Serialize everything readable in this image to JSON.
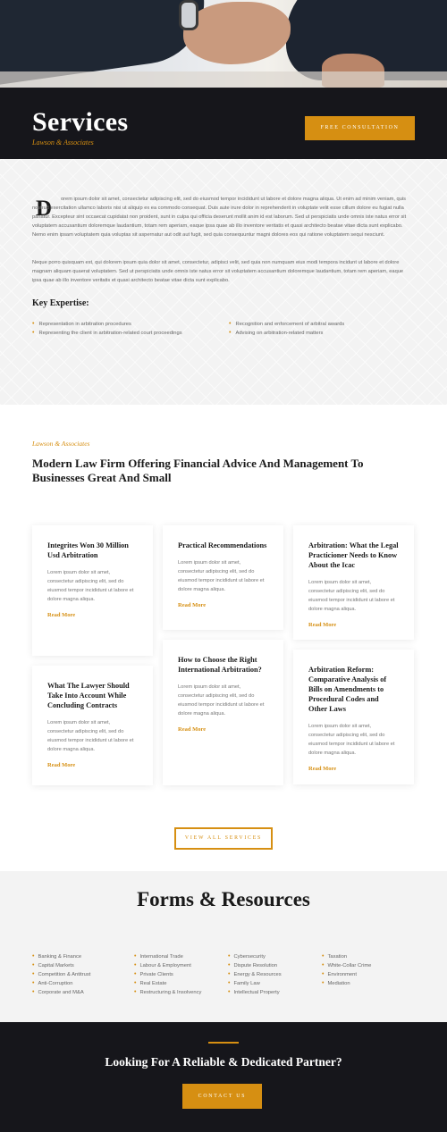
{
  "hero": {
    "title": "Services",
    "subtitle": "Lawson & Associates",
    "cta_label": "FREE CONSULTATION"
  },
  "intro": {
    "dropcap": "D",
    "paragraph1": "orem ipsum dolor sit amet, consectetur adipiscing elit, sed do eiusmod tempor incididunt ut labore et dolore magna aliqua. Ut enim ad minim veniam, quis nostrud exercitation ullamco laboris nisi ut aliquip ex ea commodo consequat. Duis aute irure dolor in reprehenderit in voluptate velit esse cillum dolore eu fugiat nulla pariatur. Excepteur sint occaecat cupidatat non proident, sunt in culpa qui officia deserunt mollit anim id est laborum. Sed ut perspiciatis unde omnis iste natus error sit voluptatem accusantium doloremque laudantium, totam rem aperiam, eaque ipsa quae ab illo inventore veritatis et quasi architecto beatae vitae dicta sunt explicabo. Nemo enim ipsam voluptatem quia voluptas sit aspernatur aut odit aut fugit, sed quia consequuntur magni dolores eos qui ratione voluptatem sequi nesciunt.",
    "paragraph2": "Neque porro quisquam est, qui dolorem ipsum quia dolor sit amet, consectetur, adipisci velit, sed quia non numquam eius modi tempora incidunt ut labore et dolore magnam aliquam quaerat voluptatem. Sed ut perspiciatis unde omnis iste natus error sit voluptatem accusantium doloremque laudantium, totam rem aperiam, eaque ipsa quae ab illo inventore veritatis et quasi architecto beatae vitae dicta sunt explicabo.",
    "expertise_title": "Key Expertise:",
    "expertise_left": [
      "Representation in arbitration procedures",
      "Representing the client in arbitration-related court proceedings"
    ],
    "expertise_right": [
      "Recognition and enforcement of arbitral awards",
      "Advising on arbitration-related matters"
    ]
  },
  "firm": {
    "eyebrow": "Lawson & Associates",
    "title": "Modern Law Firm Offering Financial Advice And Management To Businesses Great And Small",
    "read_more": "Read More",
    "cards": [
      {
        "title": "Integrites Won 30 Million Usd Arbitration",
        "body": "Lorem ipsum dolor sit amet, consectetur adipiscing elit, sed do eiusmod tempor incididunt ut labore et dolore magna aliqua."
      },
      {
        "title": "Practical Recommendations",
        "body": "Lorem ipsum dolor sit amet, consectetur adipiscing elit, sed do eiusmod tempor incididunt ut labore et dolore magna aliqua."
      },
      {
        "title": "Arbitration: What the Legal Practicioner Needs to Know About the Icac",
        "body": "Lorem ipsum dolor sit amet, consectetur adipiscing elit, sed do eiusmod tempor incididunt ut labore et dolore magna aliqua."
      },
      {
        "title": "What The Lawyer Should Take Into Account While Concluding Contracts",
        "body": "Lorem ipsum dolor sit amet, consectetur adipiscing elit, sed do eiusmod tempor incididunt ut labore et dolore magna aliqua."
      },
      {
        "title": "How to Choose the Right International Arbitration?",
        "body": "Lorem ipsum dolor sit amet, consectetur adipiscing elit, sed do eiusmod tempor incididunt ut labore et dolore magna aliqua."
      },
      {
        "title": "Arbitration Reform: Comparative Analysis of Bills on Amendments to Procedural Codes and Other Laws",
        "body": "Lorem ipsum dolor sit amet, consectetur adipiscing elit, sed do eiusmod tempor incididunt ut labore et dolore magna aliqua."
      }
    ],
    "view_all_label": "VIEW ALL SERVICES"
  },
  "forms": {
    "title": "Forms & Resources",
    "col1": [
      "Banking & Finance",
      "Capital Markets",
      "Competition & Antitrust",
      "Anti-Corruption",
      "Corporate and M&A"
    ],
    "col2": [
      "International Trade",
      "Labour & Employment",
      "Private Clients",
      "Real Estate",
      "Restructuring & Insolvency"
    ],
    "col3": [
      "Cybersecurity",
      "Dispute Resolution",
      "Energy & Resources",
      "Family Law",
      "Intellectual Property"
    ],
    "col4": [
      "Taxation",
      "White-Collar Crime",
      "Environment",
      "Mediation"
    ]
  },
  "cta": {
    "title": "Looking For A Reliable & Dedicated Partner?",
    "button_label": "CONTACT US"
  }
}
